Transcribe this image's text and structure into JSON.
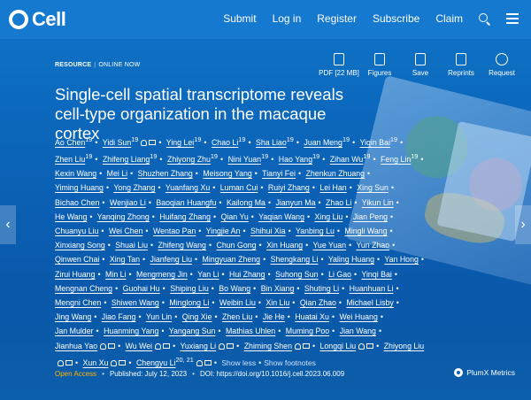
{
  "header": {
    "logo_text": "Cell",
    "nav": [
      "Submit",
      "Log in",
      "Register",
      "Subscribe",
      "Claim"
    ]
  },
  "tools": [
    {
      "label": "PDF [22 MB]",
      "icon": "pdf-icon"
    },
    {
      "label": "Figures",
      "icon": "image-icon"
    },
    {
      "label": "Save",
      "icon": "save-icon"
    },
    {
      "label": "Reprints",
      "icon": "reprints-icon"
    },
    {
      "label": "Request",
      "icon": "copyright-icon"
    }
  ],
  "article": {
    "section": "RESOURCE",
    "status": "ONLINE NOW",
    "title": "Single-cell spatial transcriptome reveals cell-type organization in the macaque cortex",
    "authors": [
      {
        "name": "Ao Chen",
        "sup": "19"
      },
      {
        "name": "Yidi Sun",
        "sup": "19",
        "icons": [
          "person",
          "mail"
        ]
      },
      {
        "name": "Ying Lei",
        "sup": "19"
      },
      {
        "name": "Chao Li",
        "sup": "19"
      },
      {
        "name": "Sha Liao",
        "sup": "19"
      },
      {
        "name": "Juan Meng",
        "sup": "19"
      },
      {
        "name": "Yiqin Bai",
        "sup": "19"
      },
      {
        "name": "Zhen Liu",
        "sup": "19"
      },
      {
        "name": "Zhifeng Liang",
        "sup": "19"
      },
      {
        "name": "Zhiyong Zhu",
        "sup": "19"
      },
      {
        "name": "Nini Yuan",
        "sup": "19"
      },
      {
        "name": "Hao Yang",
        "sup": "19"
      },
      {
        "name": "Zihan Wu",
        "sup": "19"
      },
      {
        "name": "Feng Lin",
        "sup": "19"
      },
      {
        "name": "Kexin Wang"
      },
      {
        "name": "Mei Li"
      },
      {
        "name": "Shuzhen Zhang"
      },
      {
        "name": "Meisong Yang"
      },
      {
        "name": "Tianyi Fei"
      },
      {
        "name": "Zhenkun Zhuang"
      },
      {
        "name": "Yiming Huang"
      },
      {
        "name": "Yong Zhang"
      },
      {
        "name": "Yuanfang Xu"
      },
      {
        "name": "Luman Cui"
      },
      {
        "name": "Ruiyi Zhang"
      },
      {
        "name": "Lei Han"
      },
      {
        "name": "Xing Sun"
      },
      {
        "name": "Bichao Chen"
      },
      {
        "name": "Wenjiao Li"
      },
      {
        "name": "Baoqian Huangfu"
      },
      {
        "name": "Kailong Ma"
      },
      {
        "name": "Jianyun Ma"
      },
      {
        "name": "Zhao Li"
      },
      {
        "name": "Yikun Lin"
      },
      {
        "name": "He Wang"
      },
      {
        "name": "Yanqing Zhong"
      },
      {
        "name": "Huifang Zhang"
      },
      {
        "name": "Qian Yu"
      },
      {
        "name": "Yaqian Wang"
      },
      {
        "name": "Xing Liu"
      },
      {
        "name": "Jian Peng"
      },
      {
        "name": "Chuanyu Liu"
      },
      {
        "name": "Wei Chen"
      },
      {
        "name": "Wentao Pan"
      },
      {
        "name": "Yingjie An"
      },
      {
        "name": "Shihui Xia"
      },
      {
        "name": "Yanbing Lu"
      },
      {
        "name": "Mingli Wang"
      },
      {
        "name": "Xinxiang Song"
      },
      {
        "name": "Shuai Liu"
      },
      {
        "name": "Zhifeng Wang"
      },
      {
        "name": "Chun Gong"
      },
      {
        "name": "Xin Huang"
      },
      {
        "name": "Yue Yuan"
      },
      {
        "name": "Yun Zhao"
      },
      {
        "name": "Qinwen Chai"
      },
      {
        "name": "Xing Tan"
      },
      {
        "name": "Jianfeng Liu"
      },
      {
        "name": "Mingyuan Zheng"
      },
      {
        "name": "Shengkang Li"
      },
      {
        "name": "Yaling Huang"
      },
      {
        "name": "Yan Hong"
      },
      {
        "name": "Zirui Huang"
      },
      {
        "name": "Min Li"
      },
      {
        "name": "Mengmeng Jin"
      },
      {
        "name": "Yan Li"
      },
      {
        "name": "Hui Zhang"
      },
      {
        "name": "Suhong Sun"
      },
      {
        "name": "Li Gao"
      },
      {
        "name": "Yinqi Bai"
      },
      {
        "name": "Mengnan Cheng"
      },
      {
        "name": "Guohai Hu"
      },
      {
        "name": "Shiping Liu"
      },
      {
        "name": "Bo Wang"
      },
      {
        "name": "Bin Xiang"
      },
      {
        "name": "Shuting Li"
      },
      {
        "name": "Huanhuan Li"
      },
      {
        "name": "Mengni Chen"
      },
      {
        "name": "Shiwen Wang"
      },
      {
        "name": "Minglong Li"
      },
      {
        "name": "Weibin Liu"
      },
      {
        "name": "Xin Liu"
      },
      {
        "name": "Qian Zhao"
      },
      {
        "name": "Michael Lisby"
      },
      {
        "name": "Jing Wang"
      },
      {
        "name": "Jiao Fang"
      },
      {
        "name": "Yun Lin"
      },
      {
        "name": "Qing Xie"
      },
      {
        "name": "Zhen Liu"
      },
      {
        "name": "Jie He"
      },
      {
        "name": "Huatai Xu"
      },
      {
        "name": "Wei Huang"
      },
      {
        "name": "Jan Mulder"
      },
      {
        "name": "Huanming Yang"
      },
      {
        "name": "Yangang Sun"
      },
      {
        "name": "Mathias Uhlen"
      },
      {
        "name": "Muming Poo"
      },
      {
        "name": "Jian Wang"
      },
      {
        "name": "Jianhua Yao",
        "icons": [
          "person",
          "mail"
        ]
      },
      {
        "name": "Wu Wei",
        "icons": [
          "person",
          "mail"
        ]
      },
      {
        "name": "Yuxiang Li",
        "icons": [
          "person",
          "mail"
        ]
      },
      {
        "name": "Zhiming Shen",
        "icons": [
          "person",
          "mail"
        ]
      },
      {
        "name": "Longqi Liu",
        "icons": [
          "person",
          "mail"
        ]
      },
      {
        "name": "Zhiyong Liu",
        "icons": [
          "person",
          "mail"
        ]
      },
      {
        "name": "Xun Xu",
        "icons": [
          "person",
          "mail"
        ]
      },
      {
        "name": "Chengyu Li",
        "sup": "20, 21",
        "icons": [
          "person",
          "mail"
        ]
      }
    ],
    "show_less": "Show less",
    "show_footnotes": "Show footnotes",
    "open_access": "Open Access",
    "published": "Published: July 12, 2023",
    "doi": "DOI: https://doi.org/10.1016/j.cell.2023.06.009",
    "plumx": "PlumX Metrics"
  },
  "carousel": {
    "left": "‹",
    "right": "›"
  }
}
